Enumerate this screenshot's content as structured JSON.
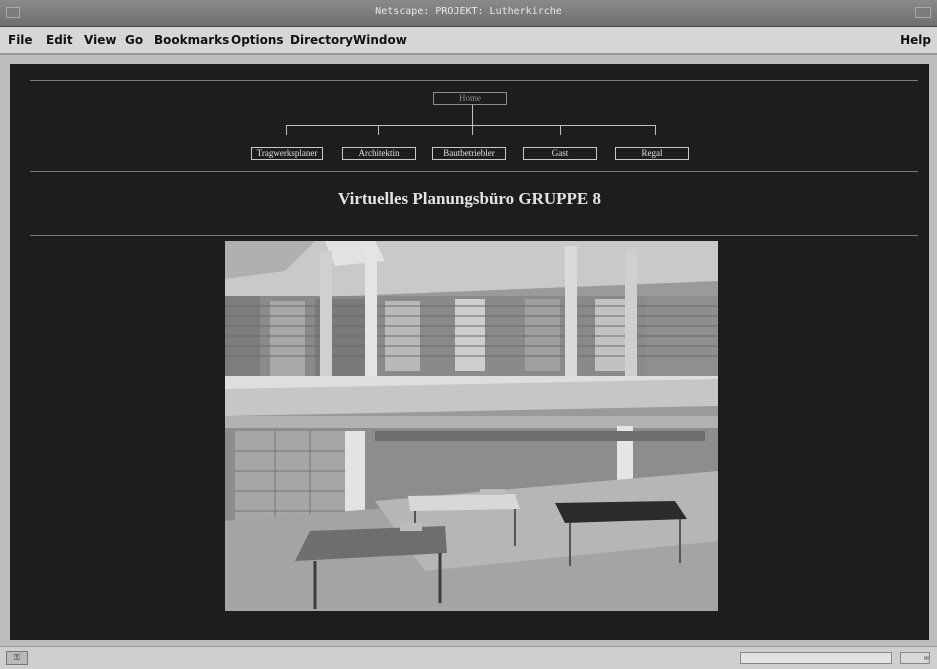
{
  "window": {
    "title": "Netscape: PROJEKT: Lutherkirche"
  },
  "menu": [
    "File",
    "Edit",
    "View",
    "Go",
    "Bookmarks",
    "Options",
    "Directory",
    "Window"
  ],
  "help_label": "Help",
  "nav": {
    "root": "Home",
    "children": [
      "Tragwerksplaner",
      "Architektin",
      "Bautbetriebler",
      "Gast",
      "Regal"
    ]
  },
  "page": {
    "heading": "Virtuelles Planungsbüro GRUPPE 8"
  },
  "status": {
    "key_icon": "security-key-icon",
    "mail_icon": "mail-icon"
  }
}
